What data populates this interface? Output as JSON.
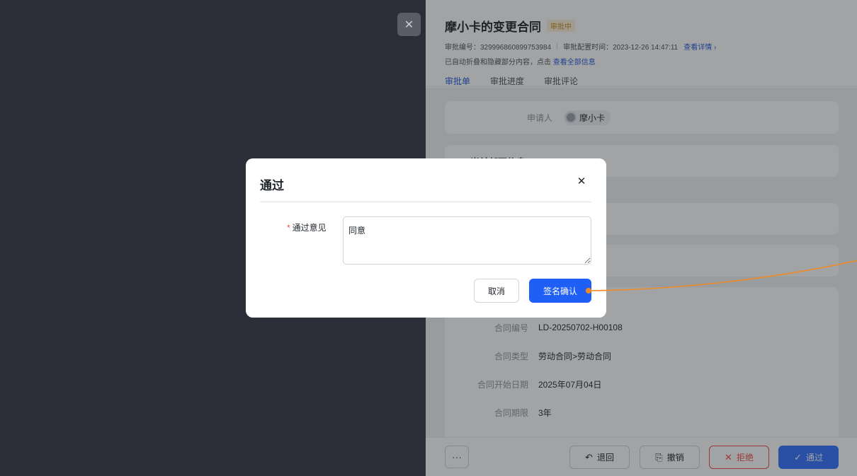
{
  "drawer": {
    "close_icon": "✕",
    "title": "摩小卡的变更合同",
    "status": "审批中",
    "approval_no": "审批编号：329996860899753984",
    "config_time": "审批配置时间：2023-12-26 14:47:11",
    "view_details": "查看详情",
    "chevron": "›",
    "note_prefix": "已自动折叠和隐藏部分内容，点击",
    "view_all": "查看全部信息",
    "tabs": [
      "审批单",
      "审批进度",
      "审批评论"
    ],
    "applicant_label": "申请人",
    "applicant_name": "摩小卡",
    "section_title": "当前任职信息",
    "details": [
      {
        "label": "合同编号",
        "value": "LD-20250702-H00108"
      },
      {
        "label": "合同类型",
        "value": "劳动合同>劳动合同"
      },
      {
        "label": "合同开始日期",
        "value": "2025年07月04日"
      },
      {
        "label": "合同期限",
        "value": "3年"
      }
    ]
  },
  "footer": {
    "more": "···",
    "return_icon": "↶",
    "return_label": "退回",
    "revoke_icon": "⎘",
    "revoke_label": "撤销",
    "reject_icon": "✕",
    "reject_label": "拒绝",
    "approve_icon": "✓",
    "approve_label": "通过"
  },
  "dialog": {
    "title": "通过",
    "close_icon": "✕",
    "required_mark": "*",
    "field_label": "通过意见",
    "field_value": "同意",
    "cancel_label": "取消",
    "confirm_label": "签名确认"
  },
  "colors": {
    "accent": "#3370ff",
    "annotation": "#f08a24",
    "status_tag": "#c28a15"
  }
}
